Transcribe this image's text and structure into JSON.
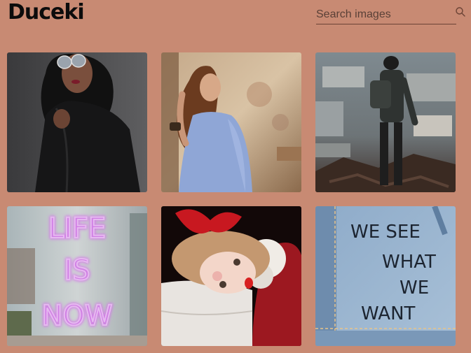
{
  "header": {
    "logo": "Duceki",
    "search": {
      "placeholder": "Search images",
      "value": ""
    }
  },
  "gallery": {
    "images": [
      {
        "subject": "woman in black coat with sunglasses"
      },
      {
        "subject": "woman in blue dress touching hair"
      },
      {
        "subject": "man with backpack overlooking city"
      },
      {
        "subject": "neon sign reading LIFE IS NOW"
      },
      {
        "subject": "girl with red bow resting on table"
      },
      {
        "subject": "denim jacket with handwritten text"
      }
    ],
    "neon_text": "LIFE IS NOW",
    "denim_text_lines": [
      "WE SEE",
      "WHAT",
      "WE",
      "WANT"
    ]
  },
  "colors": {
    "background": "#c88a73",
    "logo": "#0c0c0c"
  }
}
